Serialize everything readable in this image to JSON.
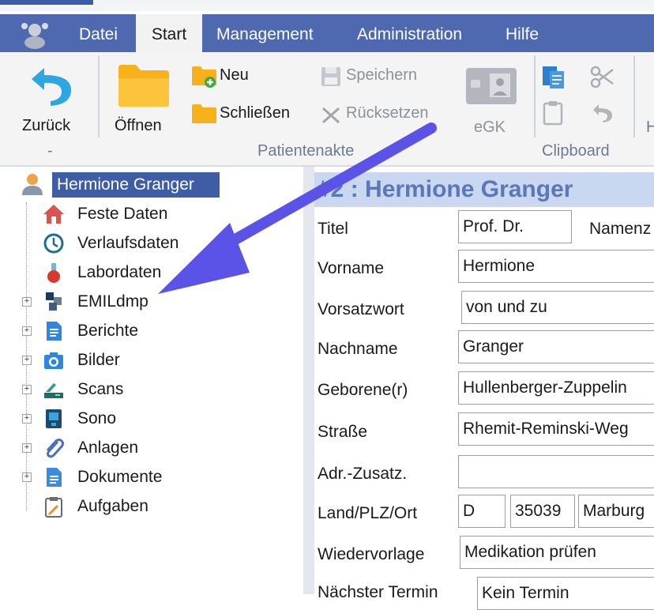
{
  "menubar": {
    "items": [
      {
        "label": "Datei"
      },
      {
        "label": "Start",
        "active": true
      },
      {
        "label": "Management"
      },
      {
        "label": "Administration"
      },
      {
        "label": "Hilfe"
      }
    ]
  },
  "ribbon": {
    "back_label": "Zurück",
    "back_group_label": "-",
    "open_label": "Öffnen",
    "new_label": "Neu",
    "close_label": "Schließen",
    "save_label": "Speichern",
    "reset_label": "Rücksetzen",
    "egk_label": "eGK",
    "patientenakte_group": "Patientenakte",
    "clipboard_group": "Clipboard",
    "trailing_group": "H"
  },
  "tree": {
    "patient": "Hermione Granger",
    "items": [
      {
        "label": "Feste Daten",
        "icon": "house-icon",
        "expandable": false
      },
      {
        "label": "Verlaufsdaten",
        "icon": "clock-icon",
        "expandable": false
      },
      {
        "label": "Labordaten",
        "icon": "flask-icon",
        "expandable": false
      },
      {
        "label": "EMILdmp",
        "icon": "dmp-icon",
        "expandable": true
      },
      {
        "label": "Berichte",
        "icon": "report-icon",
        "expandable": true
      },
      {
        "label": "Bilder",
        "icon": "camera-icon",
        "expandable": true
      },
      {
        "label": "Scans",
        "icon": "scanner-icon",
        "expandable": true
      },
      {
        "label": "Sono",
        "icon": "ultrasound-icon",
        "expandable": true
      },
      {
        "label": "Anlagen",
        "icon": "paperclip-icon",
        "expandable": true
      },
      {
        "label": "Dokumente",
        "icon": "document-icon",
        "expandable": true
      },
      {
        "label": "Aufgaben",
        "icon": "clipboard-task-icon",
        "expandable": false
      }
    ]
  },
  "form": {
    "heading": "#2 : Hermione Granger",
    "title_label": "Titel",
    "title_value": "Prof. Dr.",
    "namenszusatz_label": "Namenz",
    "vorname_label": "Vorname",
    "vorname_value": "Hermione",
    "vorsatzwort_label": "Vorsatzwort",
    "vorsatzwort_value": "von und zu",
    "nachname_label": "Nachname",
    "nachname_value": "Granger",
    "geborene_label": "Geborene(r)",
    "geborene_value": "Hullenberger-Zuppelin",
    "strasse_label": "Straße",
    "strasse_value": "Rhemit-Reminski-Weg",
    "adrzusatz_label": "Adr.-Zusatz.",
    "adrzusatz_value": "",
    "landplzort_label": "Land/PLZ/Ort",
    "land_value": "D",
    "plz_value": "35039",
    "ort_value": "Marburg",
    "wiedervorlage_label": "Wiedervorlage",
    "wiedervorlage_value": "Medikation prüfen",
    "naechster_termin_label": "Nächster Termin",
    "naechster_termin_value": "Kein Termin"
  },
  "colors": {
    "menubar": "#4e69b0",
    "selection": "#3e5da4",
    "heading_bg": "#c9d8f0",
    "heading_text": "#5a77b8",
    "annotation_arrow": "#5b52e8"
  }
}
